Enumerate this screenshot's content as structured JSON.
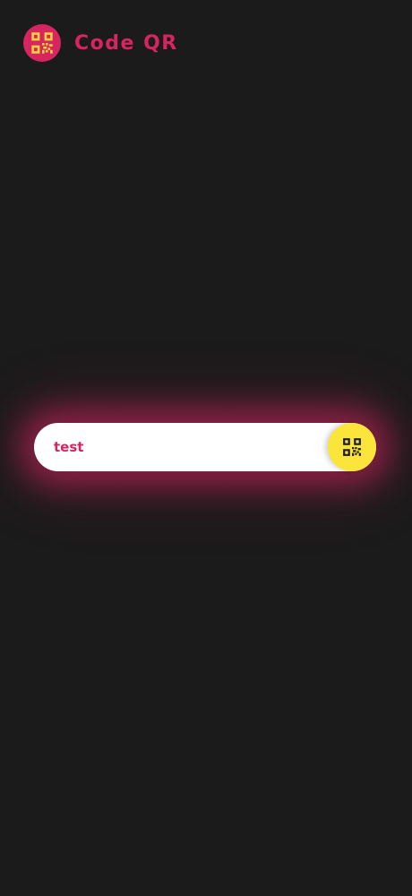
{
  "header": {
    "app_title": "Code QR",
    "logo_icon": "qr-code-icon"
  },
  "search": {
    "value": "test",
    "button_icon": "qr-code-icon"
  },
  "colors": {
    "background": "#1b1b1b",
    "accent": "#d62560",
    "logo_glyph": "#f5d23a",
    "button": "#fbe53a",
    "button_glyph": "#1b1b1b",
    "input_text": "#d62560"
  }
}
